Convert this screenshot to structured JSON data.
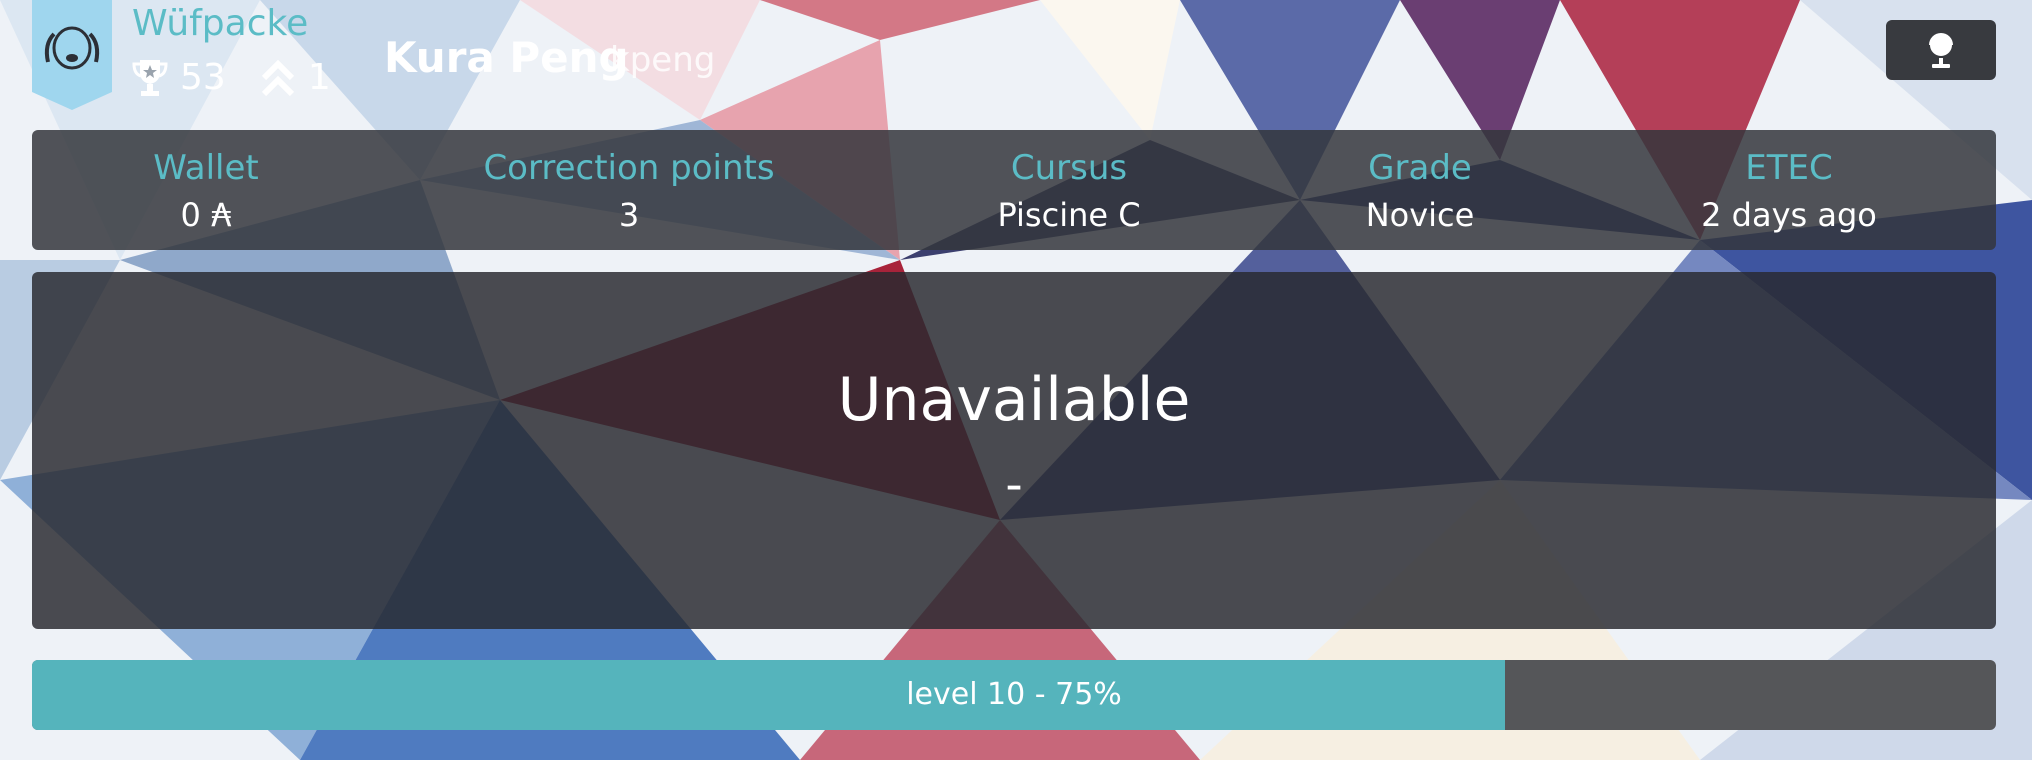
{
  "header": {
    "coalition_name": "Wüfpacke",
    "achievements_count": "53",
    "level_up_count": "1",
    "user_name": "Kura Peng",
    "user_login": "kpeng",
    "icons": {
      "coalition": "dog-crest-icon",
      "achievements": "trophy-icon",
      "levels": "chevrons-up-icon",
      "language": "globe-icon"
    }
  },
  "info_bar": {
    "items": [
      {
        "label": "Wallet",
        "value": "0 ₳"
      },
      {
        "label": "Correction points",
        "value": "3"
      },
      {
        "label": "Cursus",
        "value": "Piscine C"
      },
      {
        "label": "Grade",
        "value": "Novice"
      },
      {
        "label": "ETEC",
        "value": "2 days ago"
      }
    ]
  },
  "main": {
    "status_title": "Unavailable",
    "status_sub": "-"
  },
  "level": {
    "label": "level 10 - 75%",
    "progress": 0.75
  },
  "colors": {
    "accent": "#5bbcc6",
    "panel": "#34363c",
    "level_fill": "#55b4bc",
    "level_track": "#555659",
    "banner": "#9fd6ee"
  }
}
